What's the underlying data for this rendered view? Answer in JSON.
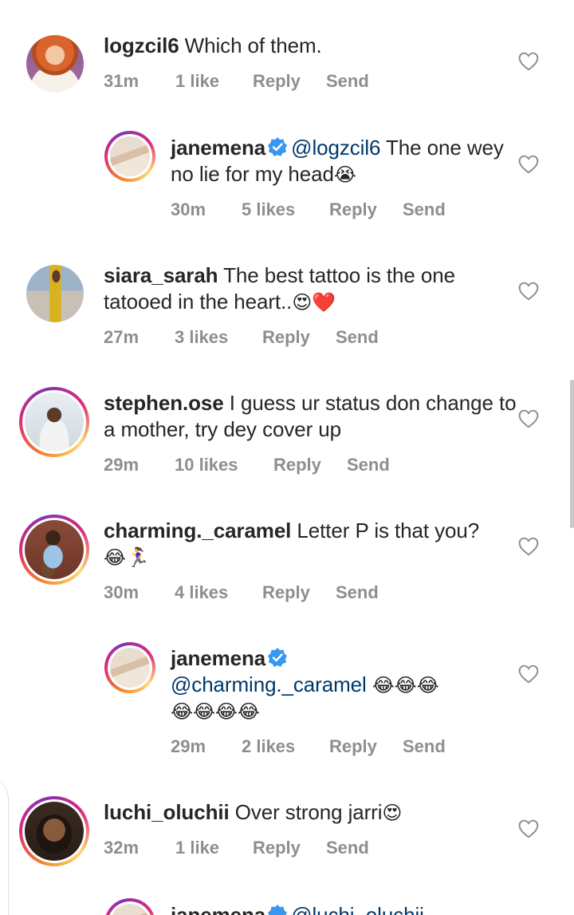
{
  "comments": [
    {
      "username": "logzcil6",
      "verified": false,
      "mention": "",
      "text": " Which of them.",
      "time": "31m",
      "likes": "1 like",
      "reply": "Reply",
      "send": "Send",
      "is_reply": false,
      "ring": false
    },
    {
      "username": "janemena",
      "verified": true,
      "mention": "@logzcil6",
      "text": " The one wey no lie for my head",
      "emoji": "😭",
      "time": "30m",
      "likes": "5 likes",
      "reply": "Reply",
      "send": "Send",
      "is_reply": true,
      "ring": true
    },
    {
      "username": "siara_sarah",
      "verified": false,
      "mention": "",
      "text": " The best tattoo is the one tatooed in the heart..",
      "emoji": "😍❤️",
      "time": "27m",
      "likes": "3 likes",
      "reply": "Reply",
      "send": "Send",
      "is_reply": false,
      "ring": false
    },
    {
      "username": "stephen.ose",
      "verified": false,
      "mention": "",
      "text": " I guess ur status don change to a mother, try dey cover up",
      "time": "29m",
      "likes": "10 likes",
      "reply": "Reply",
      "send": "Send",
      "is_reply": false,
      "ring": true
    },
    {
      "username": "charming._caramel",
      "verified": false,
      "mention": "",
      "text": " Letter P is that you?",
      "emoji": "😂🏃‍♀️",
      "time": "30m",
      "likes": "4 likes",
      "reply": "Reply",
      "send": "Send",
      "is_reply": false,
      "ring": true
    },
    {
      "username": "janemena",
      "verified": true,
      "mention": "@charming._caramel",
      "text": " ",
      "emoji": "😂😂😂😂😂😂😂",
      "time": "29m",
      "likes": "2 likes",
      "reply": "Reply",
      "send": "Send",
      "is_reply": true,
      "ring": true
    },
    {
      "username": "luchi_oluchii",
      "verified": false,
      "mention": "",
      "text": " Over strong jarri",
      "emoji": "😍",
      "time": "32m",
      "likes": "1 like",
      "reply": "Reply",
      "send": "Send",
      "is_reply": false,
      "ring": true
    }
  ],
  "partial_next": {
    "username": "janemena",
    "mention": "@luchi_oluchii"
  },
  "icons": {
    "like": "heart-outline-icon",
    "verified": "verified-badge-icon"
  },
  "colors": {
    "text": "#262626",
    "meta": "#8e8e8e",
    "mention": "#00376b",
    "verified": "#3897f0"
  }
}
